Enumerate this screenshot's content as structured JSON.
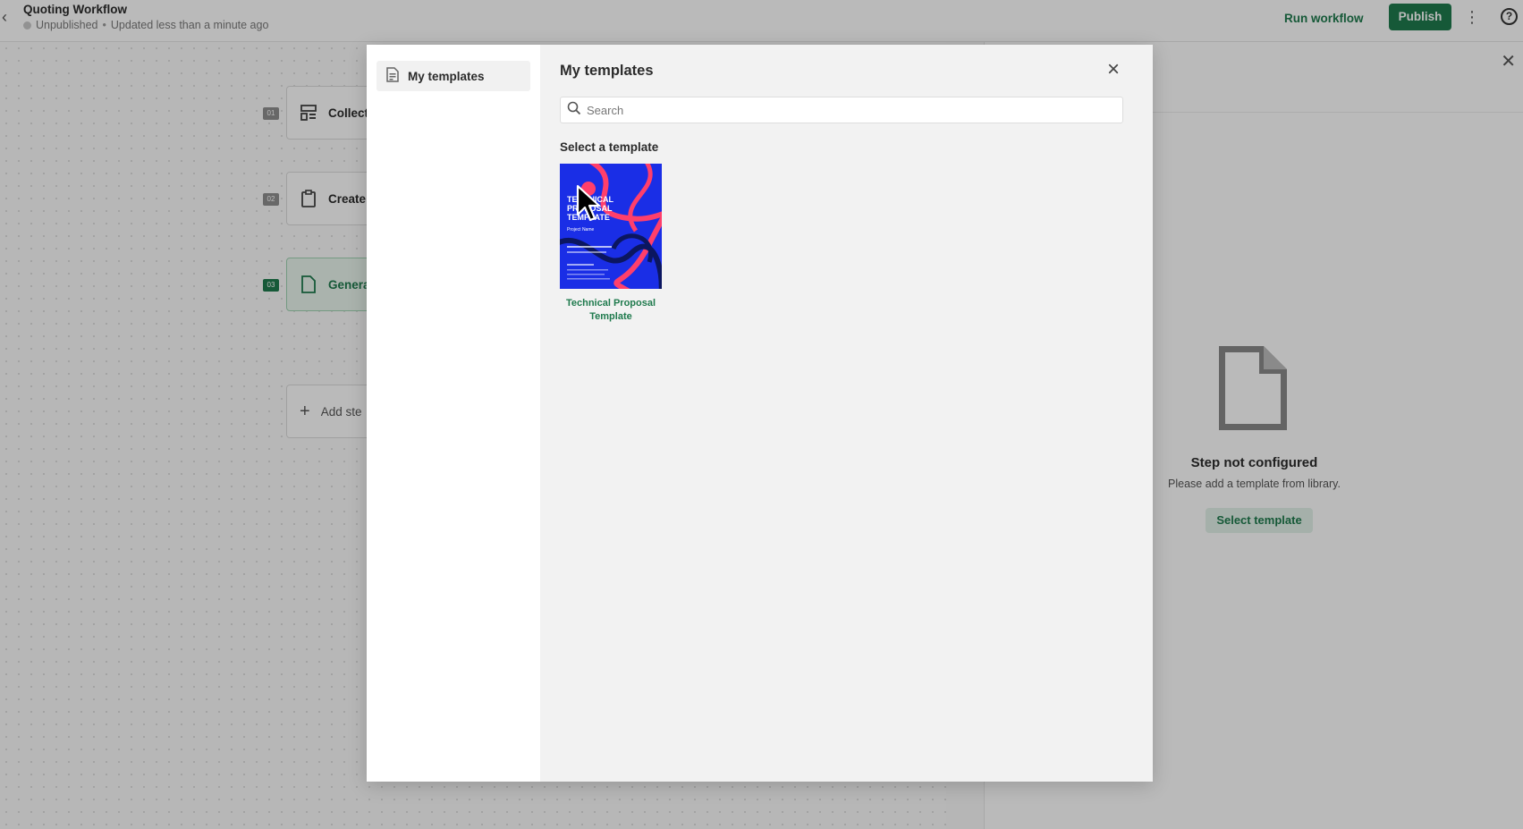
{
  "header": {
    "back_icon": "chevron-left-icon",
    "title": "Quoting Workflow",
    "status": "Unpublished",
    "separator": "•",
    "updated": "Updated less than a minute ago",
    "run_label": "Run workflow",
    "publish_label": "Publish",
    "more_icon": "more-vertical-icon",
    "help_icon": "help-circle-icon",
    "help_glyph": "?"
  },
  "steps": [
    {
      "num": "01",
      "label": "Collect",
      "icon": "form-icon"
    },
    {
      "num": "02",
      "label": "Create",
      "icon": "clipboard-icon"
    },
    {
      "num": "03",
      "label": "Genera",
      "icon": "document-icon"
    }
  ],
  "add_step_label": "Add ste",
  "right_panel": {
    "empty_title": "Step not configured",
    "empty_desc": "Please add a template from library.",
    "select_button": "Select template"
  },
  "modal": {
    "sidebar_item": "My templates",
    "title": "My templates",
    "search_placeholder": "Search",
    "select_label": "Select a template",
    "templates": [
      {
        "name": "Technical Proposal Template",
        "thumb_title_1": "TECHNICAL",
        "thumb_title_2": "PROPOSAL",
        "thumb_title_3": "TEMPLATE",
        "thumb_subtitle": "Project Name",
        "thumb_colors": {
          "bg": "#1a2ee6",
          "swirl": "#ff3f6b",
          "dark": "#0b1660"
        }
      }
    ]
  },
  "colors": {
    "accent": "#1f7a4d",
    "accent_light": "#e3f2e9"
  }
}
